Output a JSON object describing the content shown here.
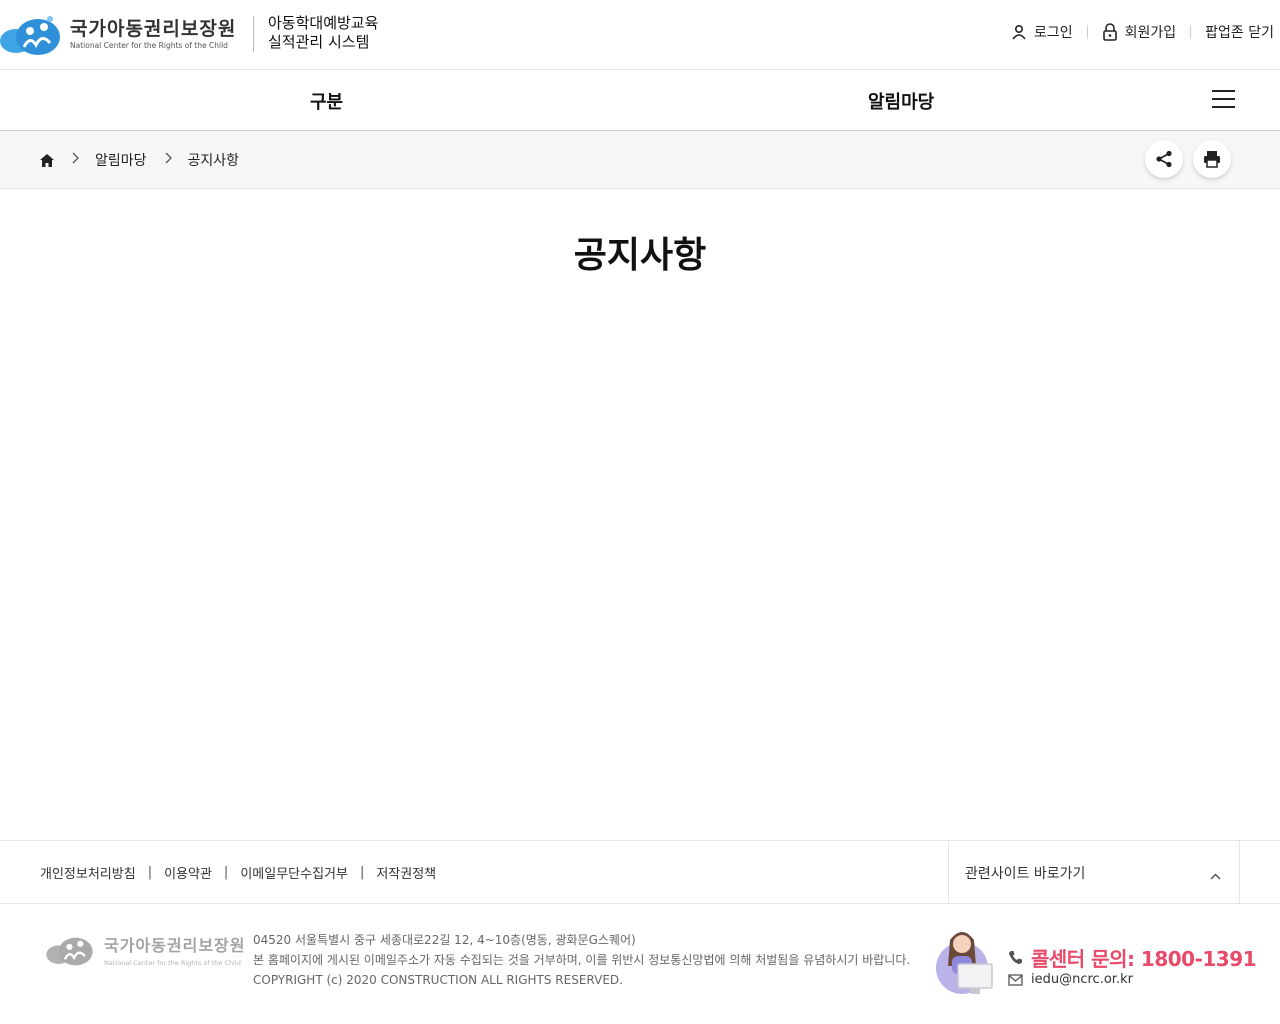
{
  "header": {
    "logo_korean": "국가아동권리보장원",
    "logo_english": "National Center for the Rights of the Child",
    "system_title_line1": "아동학대예방교육",
    "system_title_line2": "실적관리 시스템",
    "util": {
      "login": "로그인",
      "signup": "회원가입",
      "popup_close": "팝업존 닫기"
    }
  },
  "gnb": {
    "items": [
      {
        "label": "구분"
      },
      {
        "label": "알림마당"
      }
    ]
  },
  "breadcrumb": {
    "items": [
      "알림마당",
      "공지사항"
    ]
  },
  "page": {
    "title": "공지사항"
  },
  "footer": {
    "links": [
      "개인정보처리방침",
      "이용약관",
      "이메일무단수집거부",
      "저작권정책"
    ],
    "related_sites": "관련사이트 바로가기",
    "address": "04520 서울특별시 중구 세종대로22길 12, 4~10층(명동, 광화문G스퀘어)",
    "notice": "본 홈페이지에 게시된 이메일주소가 자동 수집되는 것을 거부하며, 이를 위반시 정보통신망법에 의해 처벌됨을 유념하시기 바랍니다.",
    "copyright": "COPYRIGHT (c) 2020 CONSTRUCTION ALL RIGHTS RESERVED.",
    "callcenter": "콜센터 문의: 1800-1391",
    "email": "iedu@ncrc.or.kr"
  },
  "colors": {
    "accent_pink": "#e84a6a",
    "logo_blue": "#2f8fd8"
  }
}
